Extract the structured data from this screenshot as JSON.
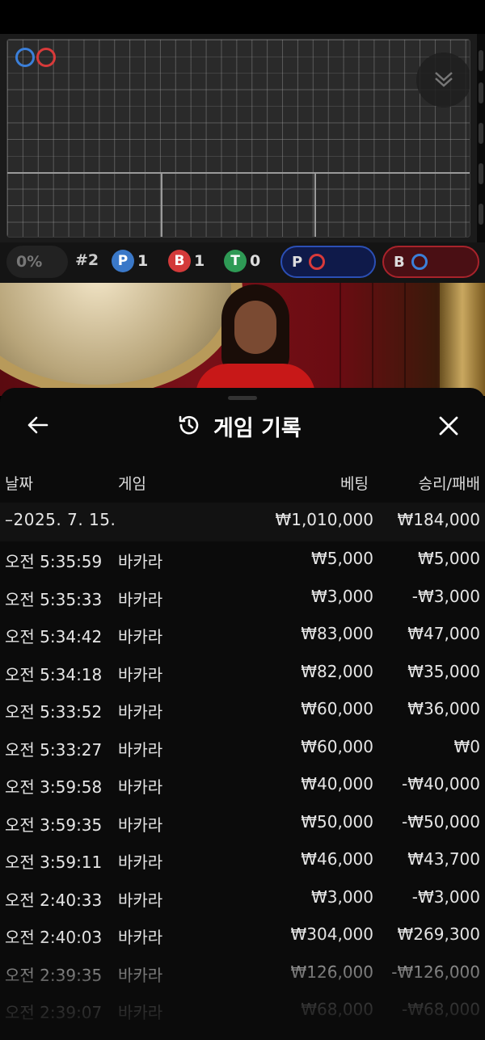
{
  "roadmap": {
    "bead_player_color": "#3b7fd9",
    "bead_banker_color": "#d83a3a",
    "collapse_icon": "double-chevron-down-icon"
  },
  "stats": {
    "percent": "0%",
    "shoe_number": "#2",
    "player": {
      "letter": "P",
      "count": "1",
      "color": "#3a78c8"
    },
    "banker": {
      "letter": "B",
      "count": "1",
      "color": "#d33a3a"
    },
    "tie": {
      "letter": "T",
      "count": "0",
      "color": "#2e9a55"
    },
    "player_prediction": {
      "letter": "P"
    },
    "banker_prediction": {
      "letter": "B"
    }
  },
  "history": {
    "title": "게임 기록",
    "back_icon": "arrow-left-icon",
    "history_icon": "history-clock-icon",
    "close_icon": "close-icon",
    "columns": {
      "date": "날짜",
      "game": "게임",
      "bet": "베팅",
      "win_loss": "승리/패배"
    },
    "summary": {
      "date": "–2025. 7. 15.",
      "bet": "₩1,010,000",
      "win_loss": "₩184,000"
    },
    "rows": [
      {
        "time": "오전 5:35:59",
        "game": "바카라",
        "bet": "₩5,000",
        "win_loss": "₩5,000"
      },
      {
        "time": "오전 5:35:33",
        "game": "바카라",
        "bet": "₩3,000",
        "win_loss": "-₩3,000"
      },
      {
        "time": "오전 5:34:42",
        "game": "바카라",
        "bet": "₩83,000",
        "win_loss": "₩47,000"
      },
      {
        "time": "오전 5:34:18",
        "game": "바카라",
        "bet": "₩82,000",
        "win_loss": "₩35,000"
      },
      {
        "time": "오전 5:33:52",
        "game": "바카라",
        "bet": "₩60,000",
        "win_loss": "₩36,000"
      },
      {
        "time": "오전 5:33:27",
        "game": "바카라",
        "bet": "₩60,000",
        "win_loss": "₩0"
      },
      {
        "time": "오전 3:59:58",
        "game": "바카라",
        "bet": "₩40,000",
        "win_loss": "-₩40,000"
      },
      {
        "time": "오전 3:59:35",
        "game": "바카라",
        "bet": "₩50,000",
        "win_loss": "-₩50,000"
      },
      {
        "time": "오전 3:59:11",
        "game": "바카라",
        "bet": "₩46,000",
        "win_loss": "₩43,700"
      },
      {
        "time": "오전 2:40:33",
        "game": "바카라",
        "bet": "₩3,000",
        "win_loss": "-₩3,000"
      },
      {
        "time": "오전 2:40:03",
        "game": "바카라",
        "bet": "₩304,000",
        "win_loss": "₩269,300"
      },
      {
        "time": "오전 2:39:35",
        "game": "바카라",
        "bet": "₩126,000",
        "win_loss": "-₩126,000"
      },
      {
        "time": "오전 2:39:07",
        "game": "바카라",
        "bet": "₩68,000",
        "win_loss": "-₩68,000"
      }
    ]
  }
}
